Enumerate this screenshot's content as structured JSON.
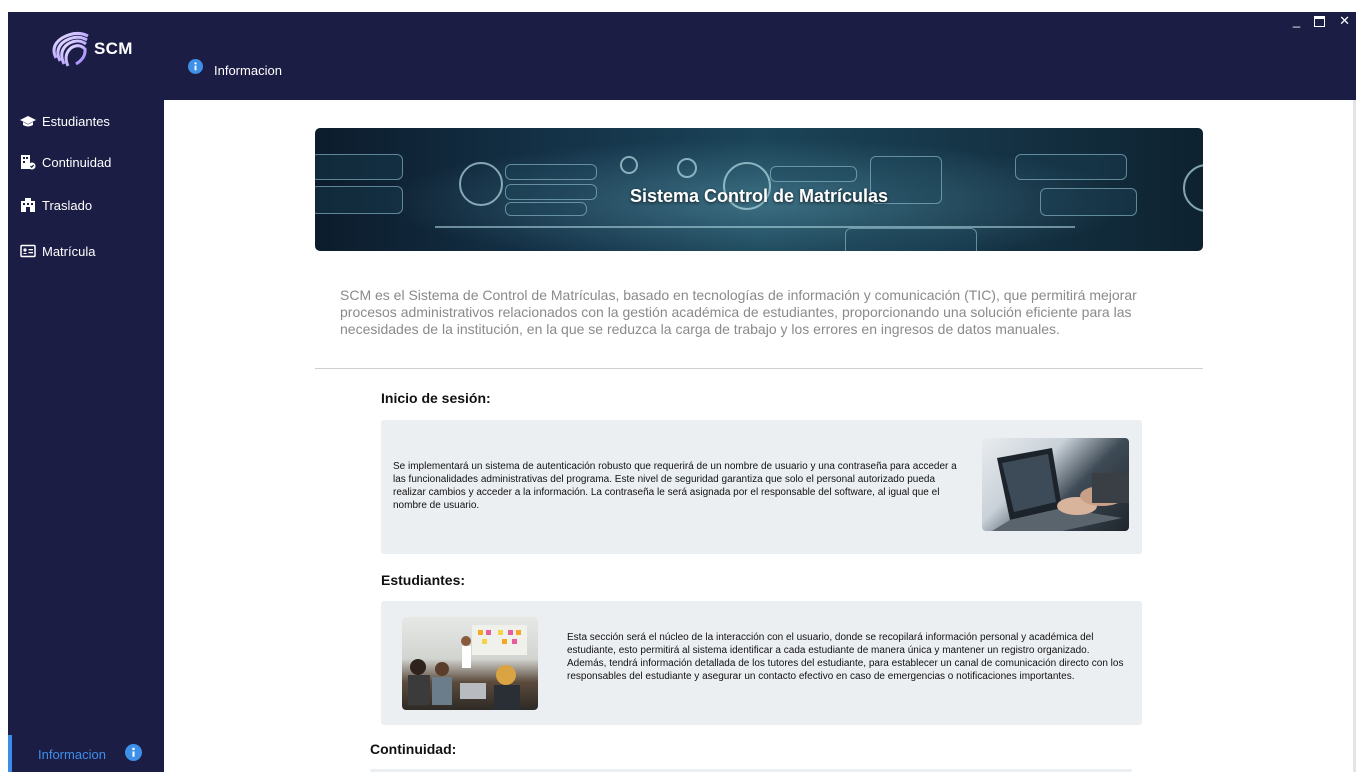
{
  "app": {
    "name": "SCM"
  },
  "window_controls": {
    "minimize": "_",
    "close": "✕"
  },
  "header": {
    "title": "Informacion"
  },
  "sidebar": {
    "items": [
      {
        "label": "Estudiantes",
        "icon": "graduation-cap-icon"
      },
      {
        "label": "Continuidad",
        "icon": "building-check-icon"
      },
      {
        "label": "Traslado",
        "icon": "building-transfer-icon"
      },
      {
        "label": "Matrícula",
        "icon": "id-card-icon"
      }
    ],
    "active": {
      "label": "Informacion",
      "icon": "info-icon"
    }
  },
  "banner": {
    "title": "Sistema Control de Matrículas"
  },
  "intro": "SCM es el Sistema de Control de Matrículas, basado en tecnologías de información y comunicación (TIC), que permitirá mejorar procesos administrativos relacionados con la gestión académica de estudiantes, proporcionando una solución eficiente para las necesidades de la institución, en la que se reduzca la carga de trabajo y los errores en ingresos de datos manuales.",
  "sections": [
    {
      "title": "Inicio de sesión:",
      "text": "Se implementará un sistema de autenticación robusto que requerirá de un nombre de usuario y una contraseña para acceder a las funcionalidades administrativas del programa. Este nivel de seguridad garantiza que solo el personal autorizado pueda realizar cambios y acceder a la información. La contraseña le será asignada por el responsable del software, al igual que el nombre de usuario."
    },
    {
      "title": "Estudiantes:",
      "text": "Esta sección será el núcleo de la interacción con el usuario, donde se recopilará información personal y académica del estudiante, esto permitirá al sistema identificar a cada estudiante de manera única y mantener un registro organizado. Además, tendrá información detallada de los tutores del estudiante, para establecer un canal de comunicación directo con los responsables del estudiante y asegurar un contacto efectivo en caso de emergencias o notificaciones importantes."
    },
    {
      "title": "Continuidad:"
    }
  ],
  "colors": {
    "sidebar": "#1c1d45",
    "accent": "#3a8ee6",
    "panel": "#eceff2"
  }
}
